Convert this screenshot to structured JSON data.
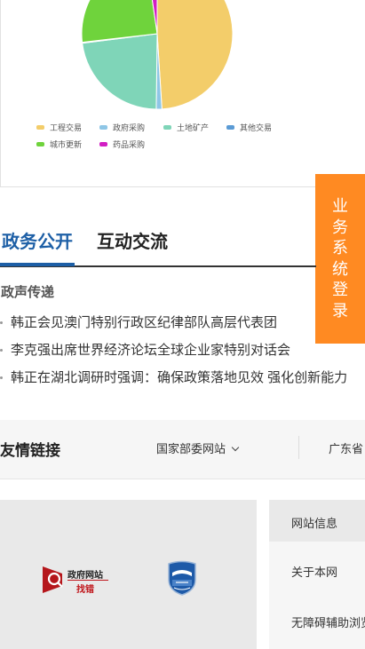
{
  "chart_data": {
    "type": "pie",
    "title": "",
    "slices": [
      {
        "name": "工程交易",
        "value": 49.0,
        "color": "#f3cd6a"
      },
      {
        "name": "政府采购",
        "value": 1.2,
        "color": "#8ec6e6"
      },
      {
        "name": "土地矿产",
        "value": 22.8,
        "color": "#7fd5b8"
      },
      {
        "name": "其他交易",
        "value": 0.2,
        "color": "#5b9bd5"
      },
      {
        "name": "城市更新",
        "value": 24.5,
        "color": "#6fd33c"
      },
      {
        "name": "药品采购",
        "value": 2.3,
        "color": "#d21ec4"
      }
    ],
    "legend": [
      "工程交易",
      "政府采购",
      "土地矿产",
      "其他交易",
      "城市更新",
      "药品采购"
    ],
    "legend_position": "bottom"
  },
  "login_tab": {
    "chars": [
      "业",
      "务",
      "系",
      "统",
      "登",
      "录"
    ]
  },
  "tabs": [
    {
      "label": "政务公开",
      "active": true
    },
    {
      "label": "互动交流",
      "active": false
    }
  ],
  "section_title": "政声传递",
  "news": [
    "韩正会见澳门特别行政区纪律部队高层代表团",
    "李克强出席世界经济论坛全球企业家特别对话会",
    "韩正在湖北调研时强调：确保政策落地见效 强化创新能力"
  ],
  "links": {
    "title": "友情链接",
    "select1": "国家部委网站",
    "select2": "广东省"
  },
  "footer": {
    "gov_logo_line1": "政府网站",
    "gov_logo_line2": "找错",
    "links": [
      "网站信息",
      "关于本网",
      "无障碍辅助浏览"
    ]
  }
}
